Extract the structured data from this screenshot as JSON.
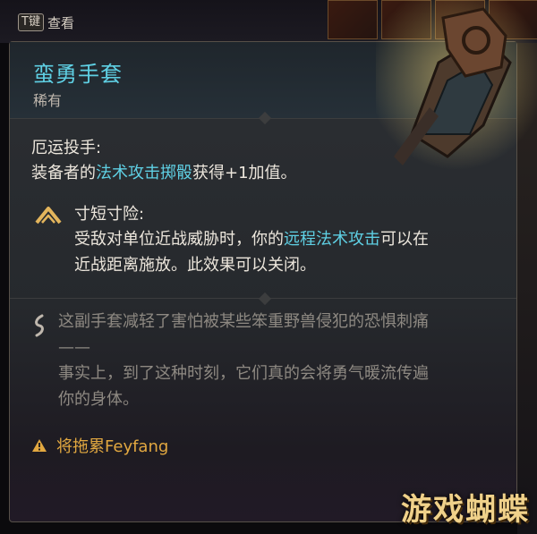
{
  "topbar": {
    "key_label": "T键",
    "view_label": "查看"
  },
  "item": {
    "name": "蛮勇手套",
    "rarity": "稀有",
    "name_color": "#5fd0e4"
  },
  "property": {
    "title": "厄运投手:",
    "text_prefix": "装备者的",
    "text_highlight": "法术攻击掷骰",
    "text_suffix": "获得+1加值。"
  },
  "passive": {
    "icon": "chevron-up-warning-icon",
    "title": "寸短寸险:",
    "line1_prefix": "受敌对单位近战威胁时，你的",
    "line1_highlight": "远程法术攻击",
    "line1_suffix": "可以在",
    "line2": "近战距离施放。此效果可以关闭。"
  },
  "lore": {
    "icon": "quill-icon",
    "line1": "这副手套减轻了害怕被某些笨重野兽侵犯的恐惧刺痛",
    "line2": "——",
    "line3": "事实上，到了这种时刻，它们真的会将勇气暖流传遍",
    "line4": "你的身体。"
  },
  "alert": {
    "icon": "warning-triangle-icon",
    "text": "将拖累Feyfang",
    "color": "#e2a840"
  },
  "watermark": {
    "text": "游戏蝴蝶"
  }
}
